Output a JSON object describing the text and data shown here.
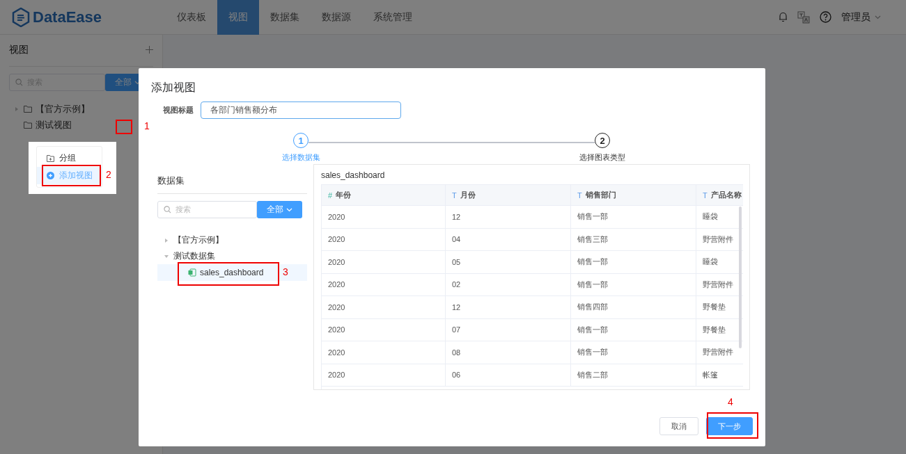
{
  "header": {
    "logo": "DataEase",
    "nav": [
      {
        "label": "仪表板",
        "selected": false
      },
      {
        "label": "视图",
        "selected": true
      },
      {
        "label": "数据集",
        "selected": false
      },
      {
        "label": "数据源",
        "selected": false
      },
      {
        "label": "系统管理",
        "selected": false
      }
    ],
    "user": "管理员"
  },
  "sidebar": {
    "title": "视图",
    "search": {
      "placeholder": "搜索"
    },
    "filter": "全部",
    "tree": [
      {
        "label": "【官方示例】",
        "kind": "expandable",
        "expanded": false
      },
      {
        "label": "测试视图",
        "kind": "plain"
      }
    ]
  },
  "context_menu": {
    "items": [
      {
        "label": "分组",
        "kind": "folder",
        "selected": false
      },
      {
        "label": "添加视图",
        "kind": "add",
        "selected": true
      }
    ]
  },
  "dialog": {
    "title": "添加视图",
    "field_label": "视图标题",
    "field_value": "各部门销售额分布",
    "steps": [
      {
        "number": "1",
        "label": "选择数据集",
        "active": true
      },
      {
        "number": "2",
        "label": "选择图表类型",
        "active": false
      }
    ],
    "dataset_panel": {
      "title": "数据集",
      "search": {
        "placeholder": "搜索"
      },
      "filter": "全部",
      "tree": [
        {
          "label": "【官方示例】",
          "expanded": false
        },
        {
          "label": "测试数据集",
          "expanded": true,
          "children": [
            {
              "label": "sales_dashboard",
              "selected": true
            }
          ]
        }
      ]
    },
    "table": {
      "title": "sales_dashboard",
      "columns": [
        {
          "type_symbol": "#",
          "kind": "number",
          "label": "年份"
        },
        {
          "type_symbol": "T",
          "kind": "text",
          "label": "月份"
        },
        {
          "type_symbol": "T",
          "kind": "text",
          "label": "销售部门"
        },
        {
          "type_symbol": "T",
          "kind": "text",
          "label": "产品名称"
        }
      ],
      "rows": [
        [
          "2020",
          "12",
          "销售一部",
          "睡袋"
        ],
        [
          "2020",
          "04",
          "销售三部",
          "野营附件"
        ],
        [
          "2020",
          "05",
          "销售一部",
          "睡袋"
        ],
        [
          "2020",
          "02",
          "销售一部",
          "野营附件"
        ],
        [
          "2020",
          "12",
          "销售四部",
          "野餐垫"
        ],
        [
          "2020",
          "07",
          "销售一部",
          "野餐垫"
        ],
        [
          "2020",
          "08",
          "销售一部",
          "野营附件"
        ],
        [
          "2020",
          "06",
          "销售二部",
          "帐篷"
        ]
      ]
    },
    "buttons": {
      "cancel": "取消",
      "next": "下一步"
    }
  },
  "annotations": [
    {
      "number": "1"
    },
    {
      "number": "2"
    },
    {
      "number": "3"
    },
    {
      "number": "4"
    }
  ]
}
